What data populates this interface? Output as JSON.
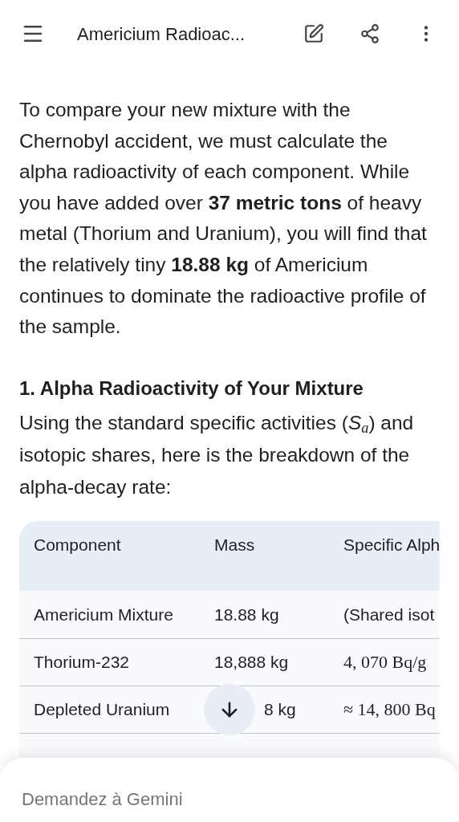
{
  "header": {
    "title": "Americium Radioac..."
  },
  "intro": "To compare your new mixture with the Chernobyl accident, we must calculate the alpha radioactivity of each component. While you have added over **37 metric tons** of heavy metal (Thorium and Uranium), you will find that the relatively tiny **18.88 kg** of Americium continues to dominate the radioactive profile of the sample.",
  "section": {
    "heading": "1. Alpha Radioactivity of Your Mixture",
    "text": "Using the standard specific activities (*S*$_{a}$) and isotopic shares, here is the breakdown of the alpha-decay rate:"
  },
  "table": {
    "columns": [
      "Component",
      "Mass",
      "Specific Alph"
    ],
    "rows": [
      [
        "Americium Mixture",
        "18.88 kg",
        "(Shared isot"
      ],
      [
        "Thorium-232",
        "18,888 kg",
        "4, 070 Bq/g"
      ],
      [
        "Depleted Uranium",
        "8 kg",
        "≈ 14, 800 Bq"
      ]
    ]
  },
  "composer": {
    "placeholder": "Demandez à Gemini"
  }
}
